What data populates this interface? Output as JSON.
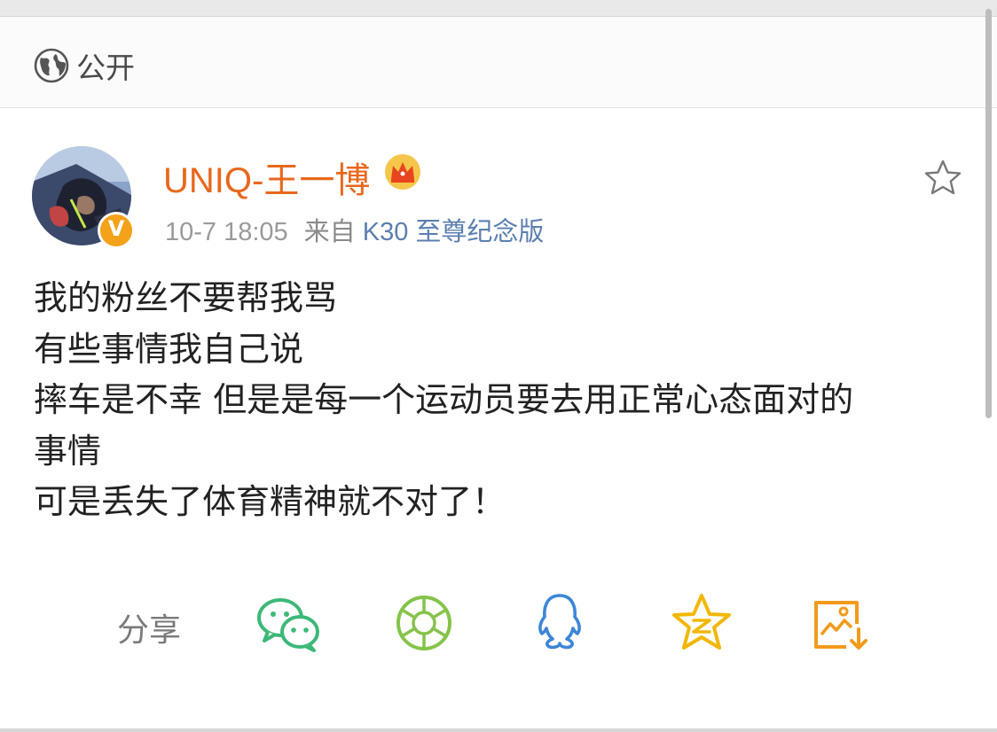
{
  "header": {
    "visibility_icon": "globe-icon",
    "visibility_label": "公开"
  },
  "post": {
    "author": "UNIQ-王一博",
    "verified_badge": "V",
    "member_icon": "crown-icon",
    "timestamp": "10-7 18:05",
    "source_prefix": "来自",
    "source_device": "K30 至尊纪念版",
    "favorite_icon": "star-outline-icon",
    "lines": [
      "我的粉丝不要帮我骂",
      "有些事情我自己说",
      "摔车是不幸 但是是每一个运动员要去用正常心态面对的",
      "事情",
      "可是丢失了体育精神就不对了！"
    ]
  },
  "share": {
    "label": "分享",
    "targets": [
      "wechat-icon",
      "moments-icon",
      "qq-icon",
      "qzone-icon",
      "save-image-icon"
    ]
  },
  "colors": {
    "author": "#e8681c",
    "device": "#5b7fb0",
    "wechat": "#3cb878",
    "moments": "#86c34a",
    "qq": "#3d86d6",
    "qzone": "#f2b705",
    "save": "#f29a1a"
  }
}
